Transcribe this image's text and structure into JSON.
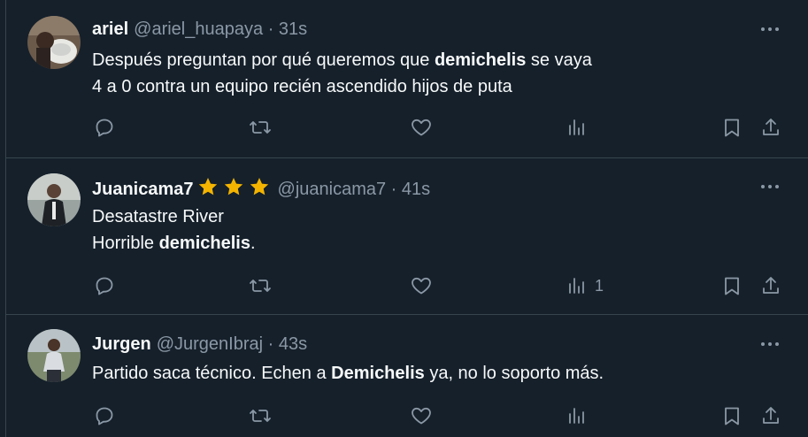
{
  "tweets": [
    {
      "name": "ariel",
      "handle": "@ariel_huapaya",
      "dot": "·",
      "time": "31s",
      "line1_pre": "Después preguntan por qué queremos que ",
      "line1_bold": "demichelis",
      "line1_post": " se vaya",
      "line2": "4 a 0 contra un equipo recién ascendido hijos de puta",
      "views_count": ""
    },
    {
      "name": "Juanicama7",
      "handle": "@juanicama7",
      "dot": "·",
      "time": "41s",
      "line1": "Desatastre River",
      "line2_pre": "Horrible ",
      "line2_bold": "demichelis",
      "line2_post": ".",
      "views_count": "1"
    },
    {
      "name": "Jurgen",
      "handle": "@JurgenIbraj",
      "dot": "·",
      "time": "43s",
      "line1_pre": "Partido saca técnico. Echen a ",
      "line1_bold": "Demichelis",
      "line1_post": " ya, no lo soporto más.",
      "views_count": ""
    }
  ],
  "colors": {
    "background": "#15202b",
    "text": "#f7f9f9",
    "secondary": "#8b98a5",
    "divider": "#38444d",
    "star": "#f4b400"
  },
  "icons": [
    "reply-icon",
    "retweet-icon",
    "like-icon",
    "views-icon",
    "bookmark-icon",
    "share-icon",
    "more-icon",
    "star-icon"
  ]
}
